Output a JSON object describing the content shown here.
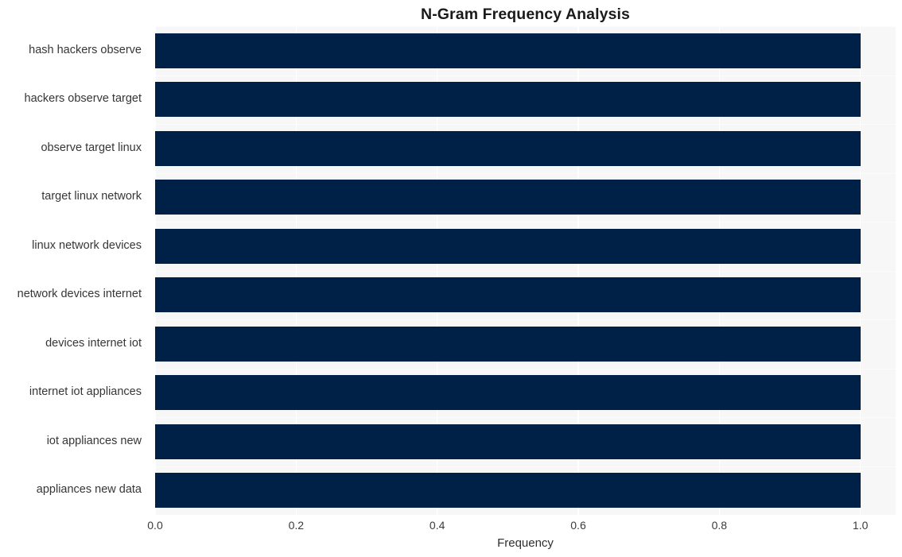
{
  "chart_data": {
    "type": "bar",
    "orientation": "horizontal",
    "title": "N-Gram Frequency Analysis",
    "xlabel": "Frequency",
    "ylabel": "",
    "categories": [
      "hash hackers observe",
      "hackers observe target",
      "observe target linux",
      "target linux network",
      "linux network devices",
      "network devices internet",
      "devices internet iot",
      "internet iot appliances",
      "iot appliances new",
      "appliances new data"
    ],
    "values": [
      1.0,
      1.0,
      1.0,
      1.0,
      1.0,
      1.0,
      1.0,
      1.0,
      1.0,
      1.0
    ],
    "xlim": [
      0.0,
      1.05
    ],
    "xticks": [
      "0.0",
      "0.2",
      "0.4",
      "0.6",
      "0.8",
      "1.0"
    ],
    "xtick_values": [
      0.0,
      0.2,
      0.4,
      0.6,
      0.8,
      1.0
    ],
    "grid": true,
    "legend": null,
    "colors": {
      "bar": "#002147",
      "plot_background": "#f7f7f7",
      "figure_background": "#ffffff",
      "gridline": "#ffffff",
      "title_text": "#1a1a1a",
      "tick_text": "#363636"
    }
  }
}
